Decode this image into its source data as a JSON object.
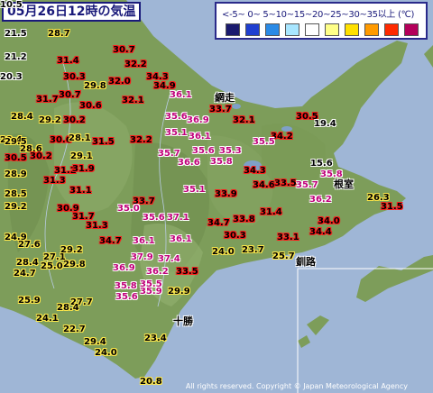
{
  "title": "05月26日12時の気温",
  "legend": {
    "scale_text": "<-5~ 0~ 5~10~15~20~25~30~35以上 (℃)",
    "colors": [
      "#1a1a6e",
      "#1f3fd0",
      "#2a8ae6",
      "#a8e6ff",
      "#ffffff",
      "#ffff88",
      "#ffe000",
      "#ff9a00",
      "#ff2a00",
      "#b4005a"
    ]
  },
  "cities": {
    "abashiri": "網走",
    "nemuro": "根室",
    "kushiro": "釧路",
    "tokachi": "十勝"
  },
  "copyright": "All rights reserved. Copyright © Japan Meteorological Agency",
  "stations": [
    {
      "v": "21.5",
      "c": "dk"
    },
    {
      "v": "28.7",
      "c": "yel"
    },
    {
      "v": "30.7",
      "c": "red"
    },
    {
      "v": "21.2",
      "c": "dk"
    },
    {
      "v": "31.4",
      "c": "red"
    },
    {
      "v": "32.2",
      "c": "red"
    },
    {
      "v": "20.3",
      "c": "dk"
    },
    {
      "v": "30.3",
      "c": "red"
    },
    {
      "v": "34.3",
      "c": "red"
    },
    {
      "v": "29.8",
      "c": "yel"
    },
    {
      "v": "32.0",
      "c": "red"
    },
    {
      "v": "34.9",
      "c": "red"
    },
    {
      "v": "30.7",
      "c": "red"
    },
    {
      "v": "36.1",
      "c": "mag"
    },
    {
      "v": "31.7",
      "c": "red"
    },
    {
      "v": "30.6",
      "c": "red"
    },
    {
      "v": "32.1",
      "c": "red"
    },
    {
      "v": "28.4",
      "c": "yel"
    },
    {
      "v": "29.2",
      "c": "yel"
    },
    {
      "v": "30.2",
      "c": "red"
    },
    {
      "v": "33.7",
      "c": "red"
    },
    {
      "v": "30.5",
      "c": "red"
    },
    {
      "v": "19.4",
      "c": "dk"
    },
    {
      "v": "29.4",
      "c": "yel"
    },
    {
      "v": "35.6",
      "c": "mag"
    },
    {
      "v": "36.9",
      "c": "mag"
    },
    {
      "v": "32.1",
      "c": "red"
    },
    {
      "v": "28.6",
      "c": "yel"
    },
    {
      "v": "30.6",
      "c": "red"
    },
    {
      "v": "28.1",
      "c": "yel"
    },
    {
      "v": "31.5",
      "c": "red"
    },
    {
      "v": "35.1",
      "c": "mag"
    },
    {
      "v": "36.1",
      "c": "mag"
    },
    {
      "v": "34.2",
      "c": "red"
    },
    {
      "v": "29.5",
      "c": "yel"
    },
    {
      "v": "35.5",
      "c": "mag"
    },
    {
      "v": "32.2",
      "c": "red"
    },
    {
      "v": "30.2",
      "c": "red"
    },
    {
      "v": "29.1",
      "c": "yel"
    },
    {
      "v": "35.7",
      "c": "mag"
    },
    {
      "v": "35.6",
      "c": "mag"
    },
    {
      "v": "35.3",
      "c": "mag"
    },
    {
      "v": "30.5",
      "c": "red"
    },
    {
      "v": "36.6",
      "c": "mag"
    },
    {
      "v": "35.8",
      "c": "mag"
    },
    {
      "v": "15.6",
      "c": "dk"
    },
    {
      "v": "31.2",
      "c": "red"
    },
    {
      "v": "31.9",
      "c": "red"
    },
    {
      "v": "34.3",
      "c": "red"
    },
    {
      "v": "35.8",
      "c": "mag"
    },
    {
      "v": "28.9",
      "c": "yel"
    },
    {
      "v": "31.3",
      "c": "red"
    },
    {
      "v": "34.6",
      "c": "red"
    },
    {
      "v": "33.5",
      "c": "red"
    },
    {
      "v": "35.7",
      "c": "mag"
    },
    {
      "v": "28.5",
      "c": "yel"
    },
    {
      "v": "31.1",
      "c": "red"
    },
    {
      "v": "35.1",
      "c": "mag"
    },
    {
      "v": "33.9",
      "c": "red"
    },
    {
      "v": "36.2",
      "c": "mag"
    },
    {
      "v": "26.3",
      "c": "yel"
    },
    {
      "v": "29.2",
      "c": "yel"
    },
    {
      "v": "33.7",
      "c": "red"
    },
    {
      "v": "31.5",
      "c": "red"
    },
    {
      "v": "30.9",
      "c": "red"
    },
    {
      "v": "35.0",
      "c": "mag"
    },
    {
      "v": "31.4",
      "c": "red"
    },
    {
      "v": "31.7",
      "c": "red"
    },
    {
      "v": "35.6",
      "c": "mag"
    },
    {
      "v": "37.1",
      "c": "mag"
    },
    {
      "v": "33.8",
      "c": "red"
    },
    {
      "v": "34.0",
      "c": "red"
    },
    {
      "v": "31.3",
      "c": "red"
    },
    {
      "v": "34.7",
      "c": "red"
    },
    {
      "v": "24.9",
      "c": "yel"
    },
    {
      "v": "27.6",
      "c": "yel"
    },
    {
      "v": "34.7",
      "c": "red"
    },
    {
      "v": "36.1",
      "c": "mag"
    },
    {
      "v": "36.1",
      "c": "mag"
    },
    {
      "v": "30.3",
      "c": "red"
    },
    {
      "v": "33.1",
      "c": "red"
    },
    {
      "v": "34.4",
      "c": "red"
    },
    {
      "v": "29.2",
      "c": "yel"
    },
    {
      "v": "24.0",
      "c": "yel"
    },
    {
      "v": "23.7",
      "c": "yel"
    },
    {
      "v": "27.1",
      "c": "yel"
    },
    {
      "v": "28.4",
      "c": "yel"
    },
    {
      "v": "37.9",
      "c": "mag"
    },
    {
      "v": "37.4",
      "c": "mag"
    },
    {
      "v": "25.7",
      "c": "yel"
    },
    {
      "v": "25.0",
      "c": "yel"
    },
    {
      "v": "29.8",
      "c": "yel"
    },
    {
      "v": "36.9",
      "c": "mag"
    },
    {
      "v": "36.2",
      "c": "mag"
    },
    {
      "v": "33.5",
      "c": "red"
    },
    {
      "v": "24.7",
      "c": "yel"
    },
    {
      "v": "35.8",
      "c": "mag"
    },
    {
      "v": "35.5",
      "c": "mag"
    },
    {
      "v": "35.6",
      "c": "mag"
    },
    {
      "v": "35.9",
      "c": "mag"
    },
    {
      "v": "29.9",
      "c": "yel"
    },
    {
      "v": "25.9",
      "c": "yel"
    },
    {
      "v": "27.7",
      "c": "yel"
    },
    {
      "v": "24.1",
      "c": "yel"
    },
    {
      "v": "28.4",
      "c": "yel"
    },
    {
      "v": "23.4",
      "c": "yel"
    },
    {
      "v": "29.4",
      "c": "yel"
    },
    {
      "v": "22.7",
      "c": "yel"
    },
    {
      "v": "24.0",
      "c": "yel"
    },
    {
      "v": "20.8",
      "c": "yel"
    },
    {
      "v": "10.5",
      "c": "dk"
    }
  ]
}
